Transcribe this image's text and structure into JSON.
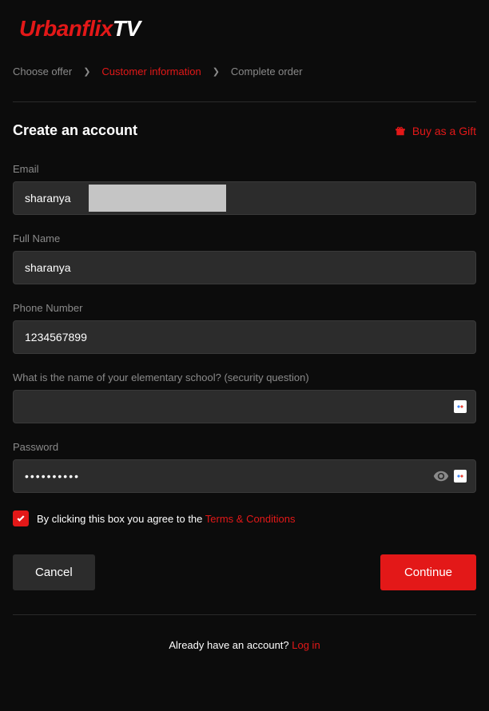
{
  "logo": {
    "part1": "Urbanflix",
    "part2": "TV"
  },
  "breadcrumb": {
    "step1": "Choose offer",
    "step2": "Customer information",
    "step3": "Complete order"
  },
  "header": {
    "title": "Create an account",
    "gift_label": "Buy as a Gift"
  },
  "form": {
    "email": {
      "label": "Email",
      "value": "sharanya"
    },
    "fullname": {
      "label": "Full Name",
      "value": "sharanya"
    },
    "phone": {
      "label": "Phone Number",
      "value": "1234567899"
    },
    "security": {
      "label": "What is the name of your elementary school? (security question)",
      "value": ""
    },
    "password": {
      "label": "Password",
      "value": "••••••••••"
    }
  },
  "terms": {
    "text": "By clicking this box you agree to the ",
    "link": "Terms & Conditions"
  },
  "buttons": {
    "cancel": "Cancel",
    "continue": "Continue"
  },
  "footer": {
    "text": "Already have an account? ",
    "login": "Log in"
  }
}
